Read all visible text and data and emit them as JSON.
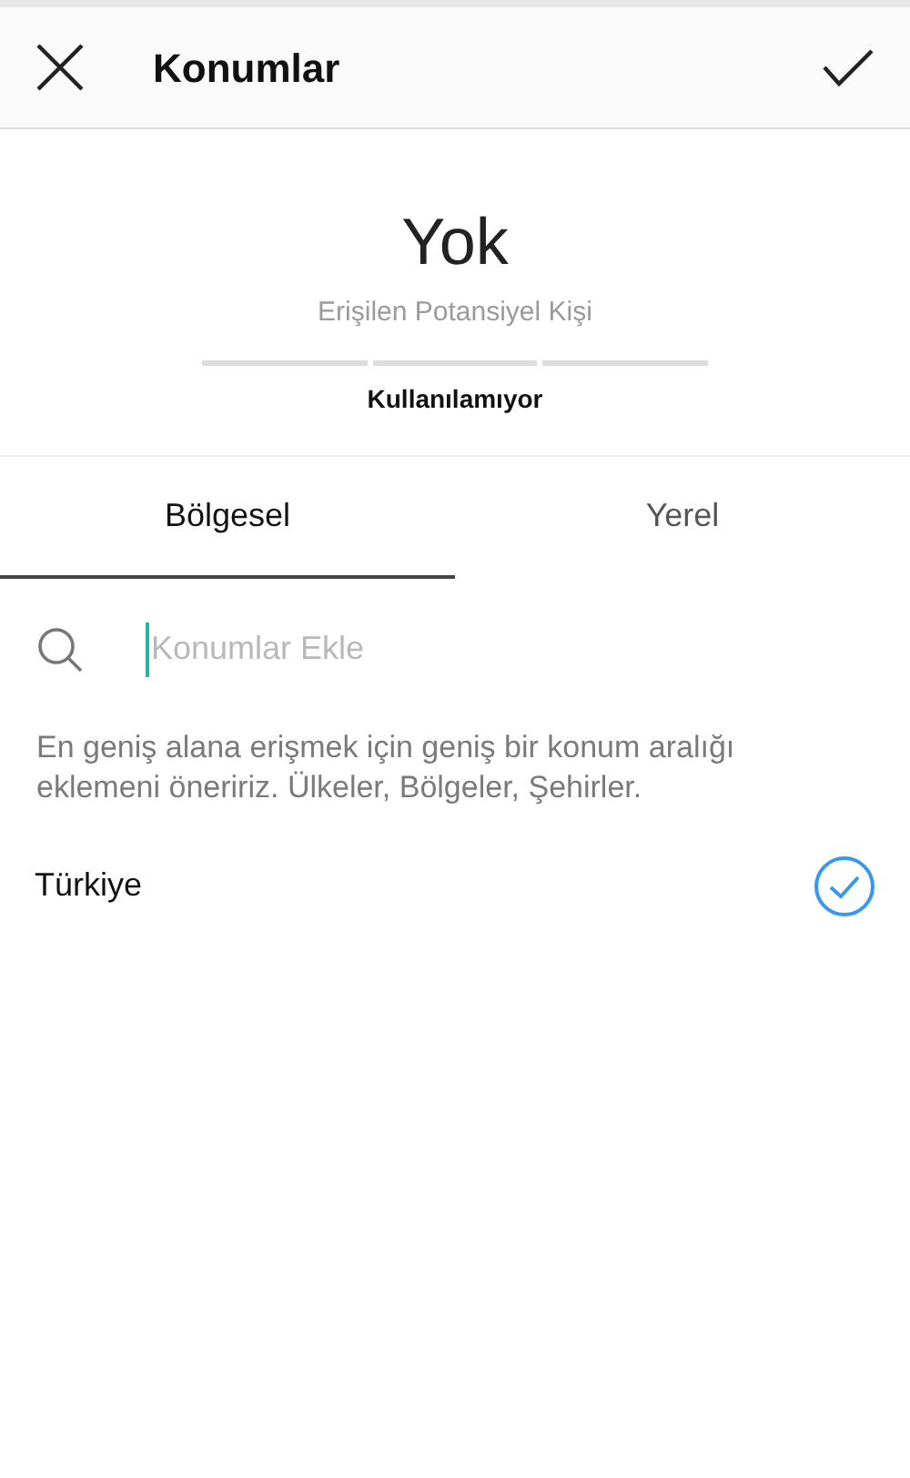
{
  "header": {
    "title": "Konumlar"
  },
  "reach": {
    "value": "Yok",
    "label": "Erişilen Potansiyel Kişi",
    "status": "Kullanılamıyor"
  },
  "tabs": [
    {
      "label": "Bölgesel",
      "selected": true
    },
    {
      "label": "Yerel",
      "selected": false
    }
  ],
  "search": {
    "placeholder": "Konumlar Ekle"
  },
  "hint": "En geniş alana erişmek için geniş bir konum aralığı eklemeni öneririz. Ülkeler, Bölgeler, Şehirler.",
  "locations": [
    {
      "name": "Türkiye",
      "selected": true
    }
  ]
}
